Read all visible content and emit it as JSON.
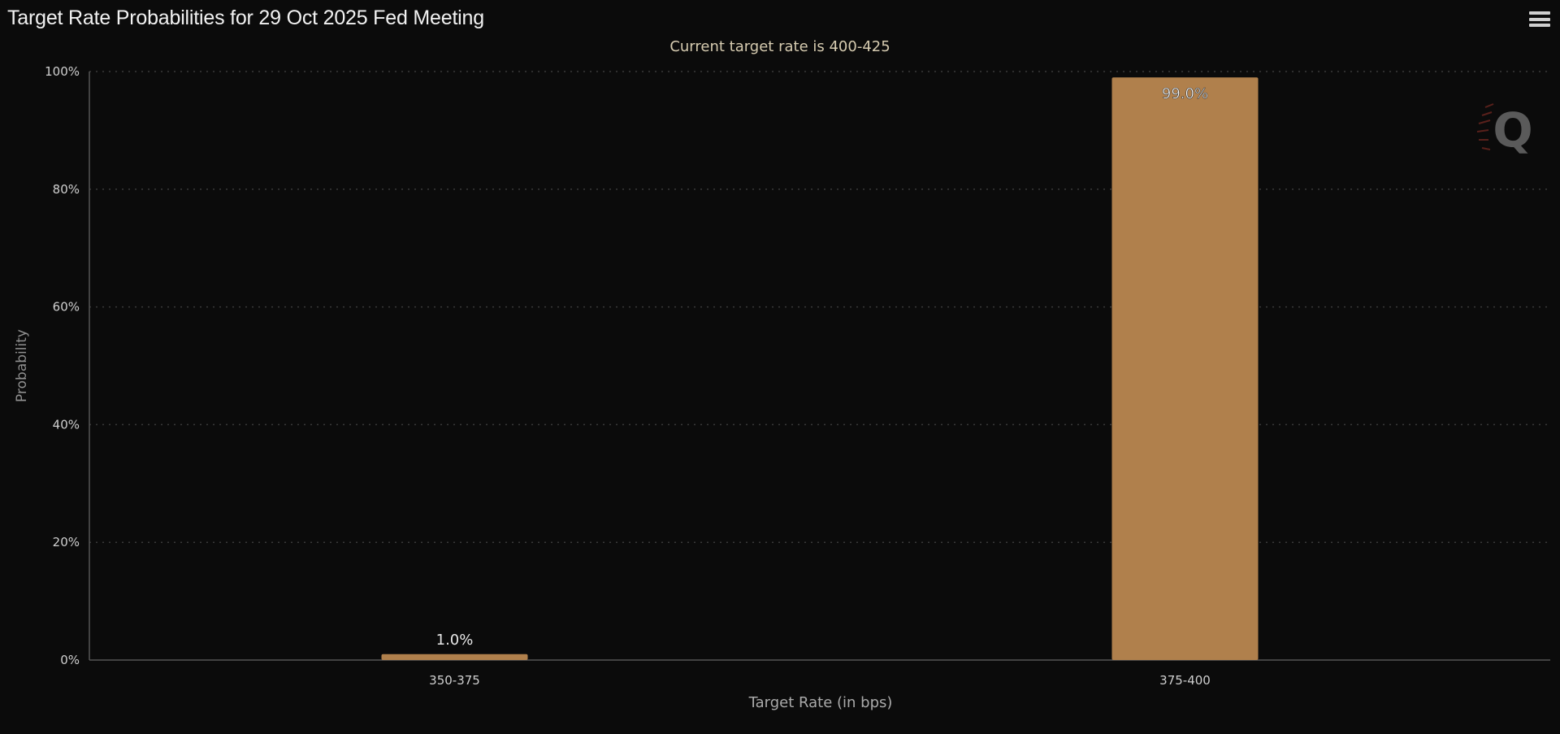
{
  "title": "Target Rate Probabilities for 29 Oct 2025 Fed Meeting",
  "subtitle": "Current target rate is 400-425",
  "watermark_letter": "Q",
  "colors": {
    "background": "#0b0b0b",
    "bar": "#b0804c",
    "grid": "#3a3a3a",
    "axis_text": "#cfcfcf"
  },
  "chart_data": {
    "type": "bar",
    "categories": [
      "350-375",
      "375-400"
    ],
    "values": [
      1.0,
      99.0
    ],
    "data_labels": [
      "1.0%",
      "99.0%"
    ],
    "xlabel": "Target Rate (in bps)",
    "ylabel": "Probability",
    "ylim": [
      0,
      100
    ],
    "yticks": [
      0,
      20,
      40,
      60,
      80,
      100
    ],
    "ytick_labels": [
      "0%",
      "20%",
      "40%",
      "60%",
      "80%",
      "100%"
    ],
    "grid": true,
    "legend": "none"
  }
}
